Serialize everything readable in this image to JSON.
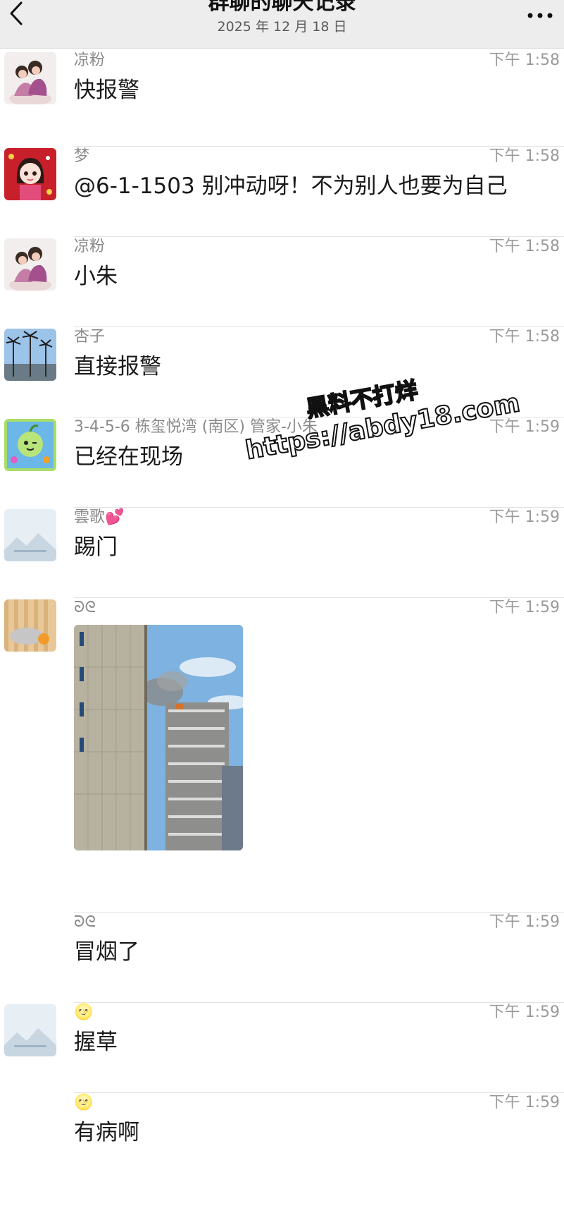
{
  "header": {
    "title": "群聊的聊天记录",
    "date": "2025 年 12 月 18 日"
  },
  "watermark": {
    "line1": "黑料不打烊",
    "line2": "https://abdy18.com"
  },
  "messages": [
    {
      "name": "凉粉",
      "time": "下午 1:58",
      "text": "快报警",
      "avatar": "girls-photo-avatar"
    },
    {
      "name": "梦",
      "time": "下午 1:58",
      "text": "@6-1-1503 别冲动呀！不为别人也要为自己",
      "avatar": "cartoon-girl-red-avatar"
    },
    {
      "name": "凉粉",
      "time": "下午 1:58",
      "text": "小朱",
      "avatar": "girls-photo-avatar"
    },
    {
      "name": "杏子",
      "time": "下午 1:58",
      "text": "直接报警",
      "avatar": "palm-trees-avatar"
    },
    {
      "name": "3-4-5-6 栋玺悦湾 (南区) 管家-小朱",
      "time": "下午 1:59",
      "text": "已经在现场",
      "avatar": "green-cartoon-avatar"
    },
    {
      "name": "雲歌💕",
      "time": "下午 1:59",
      "text": "踢门",
      "avatar": "default-landscape-avatar"
    },
    {
      "name": "ᘐᘓ",
      "time": "下午 1:59",
      "text": "",
      "avatar": "sleeping-pet-avatar",
      "image": "building-smoke-photo"
    },
    {
      "name": "ᘐᘓ",
      "time": "下午 1:59",
      "text": "冒烟了",
      "avatar": ""
    },
    {
      "name": "🌝",
      "time": "下午 1:59",
      "text": "握草",
      "avatar": "default-landscape-avatar"
    },
    {
      "name": "🌝",
      "time": "下午 1:59",
      "text": "有病啊",
      "avatar": ""
    }
  ]
}
